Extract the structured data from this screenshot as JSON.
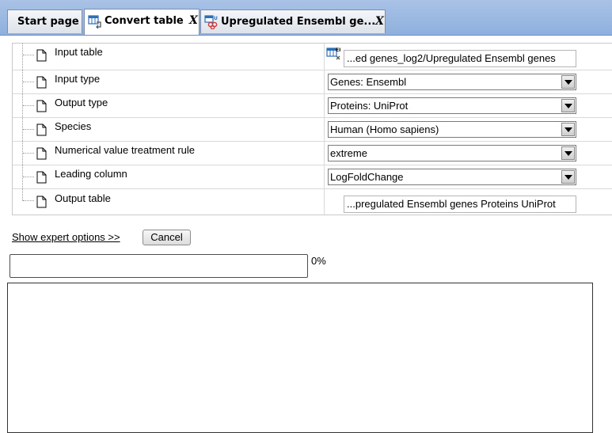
{
  "tabs": [
    {
      "label": "Start page",
      "closable": false,
      "active": false,
      "icon": null
    },
    {
      "label": "Convert table",
      "closable": true,
      "active": true,
      "icon": "convert-table-icon"
    },
    {
      "label": "Upregulated Ensembl ge...",
      "closable": true,
      "active": false,
      "icon": "table-genes-icon"
    }
  ],
  "close_glyph": "X",
  "parameters": {
    "input_table": {
      "label": "Input table",
      "value": "...ed genes_log2/Upregulated Ensembl genes"
    },
    "input_type": {
      "label": "Input type",
      "value": "Genes: Ensembl"
    },
    "output_type": {
      "label": "Output type",
      "value": "Proteins: UniProt"
    },
    "species": {
      "label": "Species",
      "value": "Human (Homo sapiens)"
    },
    "numerical_rule": {
      "label": "Numerical value treatment rule",
      "value": "extreme"
    },
    "leading_column": {
      "label": "Leading column",
      "value": "LogFoldChange"
    },
    "output_table": {
      "label": "Output table",
      "value": "...pregulated Ensembl genes Proteins UniProt"
    }
  },
  "expert_link": "Show expert options >>",
  "cancel_label": "Cancel",
  "progress": {
    "fraction": 0.0,
    "text": "0%"
  },
  "log_text": "",
  "colors": {
    "tabbar": "#9fbbe3",
    "progress_fill": "#4a7fc9"
  }
}
